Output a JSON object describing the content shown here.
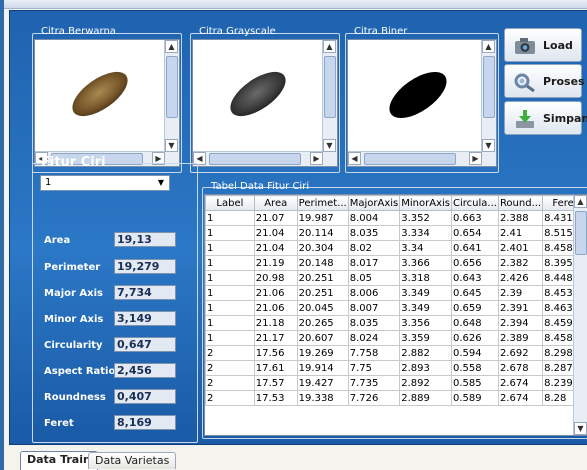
{
  "images": {
    "color_label": "Citra Berwarna",
    "gray_label": "Citra Grayscale",
    "binary_label": "Citra Biner"
  },
  "buttons": {
    "load": "Load",
    "process": "Proses",
    "save": "Simpan"
  },
  "features": {
    "title": "Fitur Ciri",
    "combo_value": "1",
    "items": [
      {
        "label": "Area",
        "value": "19,13"
      },
      {
        "label": "Perimeter",
        "value": "19,279"
      },
      {
        "label": "Major Axis",
        "value": "7,734"
      },
      {
        "label": "Minor Axis",
        "value": "3,149"
      },
      {
        "label": "Circularity",
        "value": "0,647"
      },
      {
        "label": "Aspect Ratio",
        "value": "2,456"
      },
      {
        "label": "Roundness",
        "value": "0,407"
      },
      {
        "label": "Feret",
        "value": "8,169"
      }
    ]
  },
  "table": {
    "title": "Tabel Data Fitur Ciri",
    "columns": [
      "Label",
      "Area",
      "Perimet...",
      "MajorAxis",
      "MinorAxis",
      "Circula...",
      "Round...",
      "Feret"
    ],
    "rows": [
      [
        "1",
        "21.07",
        "19.987",
        "8.004",
        "3.352",
        "0.663",
        "2.388",
        "8.431"
      ],
      [
        "1",
        "21.04",
        "20.114",
        "8.035",
        "3.334",
        "0.654",
        "2.41",
        "8.515"
      ],
      [
        "1",
        "21.04",
        "20.304",
        "8.02",
        "3.34",
        "0.641",
        "2.401",
        "8.458"
      ],
      [
        "1",
        "21.19",
        "20.148",
        "8.017",
        "3.366",
        "0.656",
        "2.382",
        "8.395"
      ],
      [
        "1",
        "20.98",
        "20.251",
        "8.05",
        "3.318",
        "0.643",
        "2.426",
        "8.448"
      ],
      [
        "1",
        "21.06",
        "20.251",
        "8.006",
        "3.349",
        "0.645",
        "2.39",
        "8.453"
      ],
      [
        "1",
        "21.06",
        "20.045",
        "8.007",
        "3.349",
        "0.659",
        "2.391",
        "8.463"
      ],
      [
        "1",
        "21.18",
        "20.265",
        "8.035",
        "3.356",
        "0.648",
        "2.394",
        "8.459"
      ],
      [
        "1",
        "21.17",
        "20.607",
        "8.024",
        "3.359",
        "0.626",
        "2.389",
        "8.458"
      ],
      [
        "2",
        "17.56",
        "19.269",
        "7.758",
        "2.882",
        "0.594",
        "2.692",
        "8.298"
      ],
      [
        "2",
        "17.61",
        "19.914",
        "7.75",
        "2.893",
        "0.558",
        "2.678",
        "8.287"
      ],
      [
        "2",
        "17.57",
        "19.427",
        "7.735",
        "2.892",
        "0.585",
        "2.674",
        "8.239"
      ],
      [
        "2",
        "17.53",
        "19.338",
        "7.726",
        "2.889",
        "0.589",
        "2.674",
        "8.28"
      ]
    ]
  },
  "tabs": [
    "Data Train",
    "Data Varietas"
  ],
  "colors": {
    "panel": "#2b78c6",
    "accent": "#1f63b0"
  }
}
